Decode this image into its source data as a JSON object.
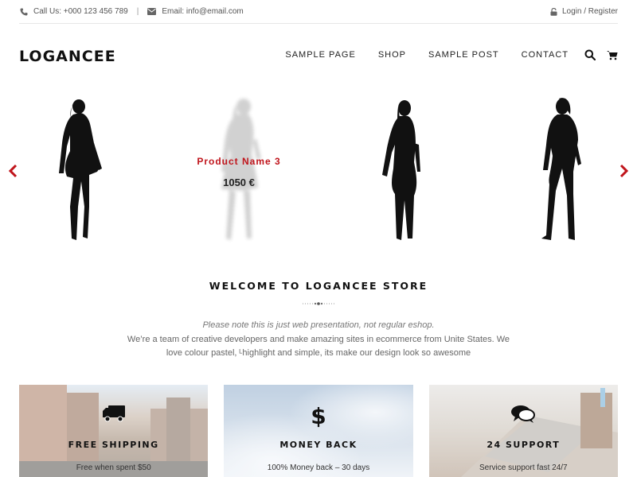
{
  "topbar": {
    "phone": "Call Us: +000 123 456 789",
    "separator": "|",
    "email": "Email: info@email.com",
    "login": "Login / Register"
  },
  "header": {
    "logo": "LOGANCEE",
    "nav": [
      "SAMPLE PAGE",
      "SHOP",
      "SAMPLE POST",
      "CONTACT"
    ],
    "icons": [
      "search-icon",
      "cart-icon"
    ]
  },
  "slider": {
    "product_name": "Product Name 3",
    "product_price": "1050 €",
    "accent": "#c0151c"
  },
  "welcome": {
    "title": "WELCOME TO LOGANCEE STORE",
    "intro": "Please note this is just web presentation, not regular eshop.",
    "desc": "We’re a team of creative developers and make amazing sites in ecommerce from Unite States. We love colour pastel, ᴸhighlight and simple, its make our design look so awesome"
  },
  "features": [
    {
      "title": "FREE SHIPPING",
      "subtitle": "Free when spent $50",
      "icon": "truck-icon"
    },
    {
      "title": "MONEY BACK",
      "subtitle": "100% Money back – 30 days",
      "icon": "dollar-icon"
    },
    {
      "title": "24 SUPPORT",
      "subtitle": "Service support fast 24/7",
      "icon": "chat-icon"
    }
  ]
}
